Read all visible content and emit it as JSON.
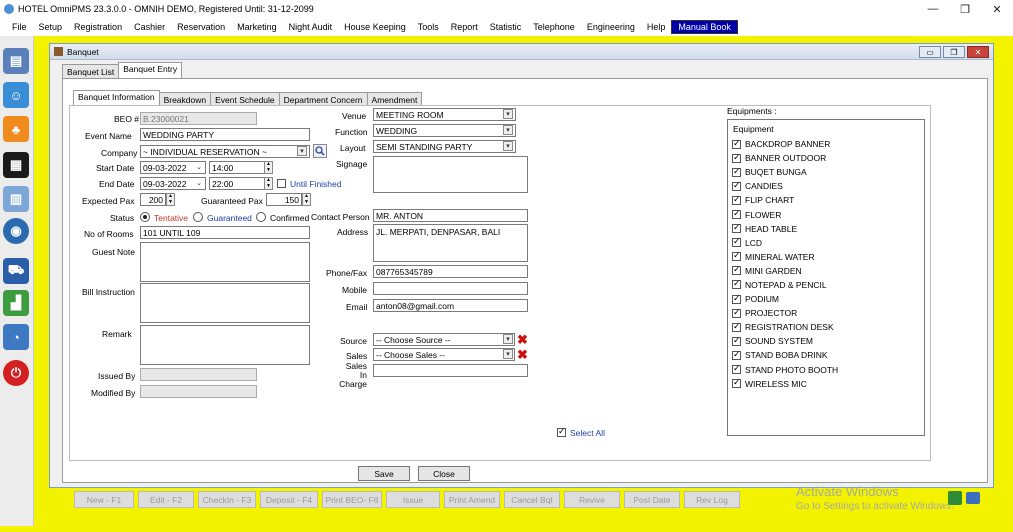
{
  "app_title": "HOTEL OmniPMS 23.3.0.0 - OMNIH DEMO, Registered Until: 31-12-2099",
  "menu": [
    "File",
    "Setup",
    "Registration",
    "Cashier",
    "Reservation",
    "Marketing",
    "Night Audit",
    "House Keeping",
    "Tools",
    "Report",
    "Statistic",
    "Telephone",
    "Engineering",
    "Help",
    "Manual Book"
  ],
  "window_title": "Banquet",
  "top_tabs": [
    "Banquet List",
    "Banquet Entry"
  ],
  "inner_tabs": [
    "Banquet Information",
    "Breakdown",
    "Event Schedule",
    "Department Concern",
    "Amendment"
  ],
  "labels": {
    "beo": "BEO #",
    "event_name": "Event Name",
    "company": "Company",
    "start_date": "Start Date",
    "end_date": "End Date",
    "expected_pax": "Expected Pax",
    "guaranteed_pax": "Guaranteed Pax",
    "status": "Status",
    "no_of_rooms": "No of Rooms",
    "guest_note": "Guest Note",
    "bill_instruction": "Bill Instruction",
    "remark": "Remark",
    "issued_by": "Issued By",
    "modified_by": "Modified By",
    "venue": "Venue",
    "function": "Function",
    "layout": "Layout",
    "signage": "Signage",
    "contact_person": "Contact Person",
    "address": "Address",
    "phone_fax": "Phone/Fax",
    "mobile": "Mobile",
    "email": "Email",
    "source": "Source",
    "sales": "Sales",
    "sales_in_charge": "Sales In Charge",
    "until_finished": "Until Finished",
    "equipments": "Equipments :",
    "select_all": "Select All"
  },
  "values": {
    "beo": "B.23000021",
    "event_name": "WEDDING PARTY",
    "company": "~ INDIVIDUAL RESERVATION ~",
    "start_date": "09-03-2022",
    "start_time": "14:00",
    "end_date": "09-03-2022",
    "end_time": "22:00",
    "expected_pax": "200",
    "guaranteed_pax": "150",
    "no_of_rooms": "101 UNTIL 109",
    "venue": "MEETING ROOM",
    "function": "WEDDING",
    "layout": "SEMI STANDING PARTY",
    "contact_person": "MR. ANTON",
    "address": "JL. MERPATI, DENPASAR, BALI",
    "phone_fax": "087765345789",
    "mobile": "",
    "email": "anton08@gmail.com",
    "source": "-- Choose Source --",
    "sales": "-- Choose Sales --"
  },
  "status_options": [
    {
      "label": "Tentative",
      "selected": true,
      "color": "#c0392b"
    },
    {
      "label": "Guaranteed",
      "selected": false,
      "color": "#1a3fa8"
    },
    {
      "label": "Confirmed",
      "selected": false,
      "color": "#000000"
    }
  ],
  "equipment_header": "Equipment",
  "equipments": [
    "BACKDROP BANNER",
    "BANNER OUTDOOR",
    "BUQET BUNGA",
    "CANDIES",
    "FLIP CHART",
    "FLOWER",
    "HEAD TABLE",
    "LCD",
    "MINERAL WATER",
    "MINI GARDEN",
    "NOTEPAD & PENCIL",
    "PODIUM",
    "PROJECTOR",
    "REGISTRATION DESK",
    "SOUND SYSTEM",
    "STAND BOBA DRINK",
    "STAND PHOTO BOOTH",
    "WIRELESS MIC"
  ],
  "buttons": {
    "save": "Save",
    "close": "Close"
  },
  "bottom_buttons": [
    "New - F1",
    "Edit - F2",
    "CheckIn - F3",
    "Deposit - F4",
    "Print BEO- F6",
    "Issue",
    "Print Amend",
    "Cancel Bqt",
    "Revive",
    "Post Date",
    "Rev Log"
  ],
  "watermark": {
    "line1": "Activate Windows",
    "line2": "Go to Settings to activate Windows."
  },
  "colors": {
    "mdi_background": "#f3f300",
    "menu_highlight": "#0000aa",
    "link_blue": "#1a3fa8"
  }
}
